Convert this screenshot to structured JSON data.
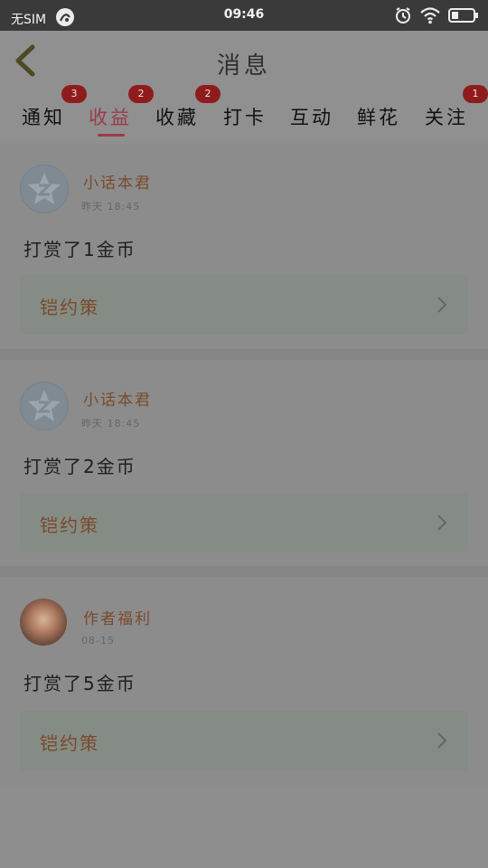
{
  "status_bar": {
    "carrier": "无SIM",
    "time": "09:46"
  },
  "header": {
    "title": "消息"
  },
  "tabs": [
    {
      "label": "通知",
      "badge": "3"
    },
    {
      "label": "收益",
      "badge": "2",
      "active": true
    },
    {
      "label": "收藏",
      "badge": "2"
    },
    {
      "label": "打卡"
    },
    {
      "label": "互动"
    },
    {
      "label": "鲜花"
    },
    {
      "label": "关注",
      "badge": "1"
    }
  ],
  "messages": [
    {
      "user": "小话本君",
      "time": "昨天 18:45",
      "text": "打赏了1金币",
      "link": "铠约策",
      "avatar": "default"
    },
    {
      "user": "小话本君",
      "time": "昨天 18:45",
      "text": "打赏了2金币",
      "link": "铠约策",
      "avatar": "default"
    },
    {
      "user": "作者福利",
      "time": "08-15",
      "text": "打赏了5金币",
      "link": "铠约策",
      "avatar": "photo"
    }
  ],
  "colors": {
    "overlay_bg": "#8e8e8e",
    "accent": "#9b3a4a",
    "username": "#7a4a2c",
    "badge": "#8f1c1c"
  },
  "icons": {
    "back": "chevron-left-icon",
    "arrow": "chevron-right-icon",
    "alarm": "alarm-icon",
    "wifi": "wifi-icon",
    "battery": "battery-icon",
    "app": "app-circle-icon"
  }
}
